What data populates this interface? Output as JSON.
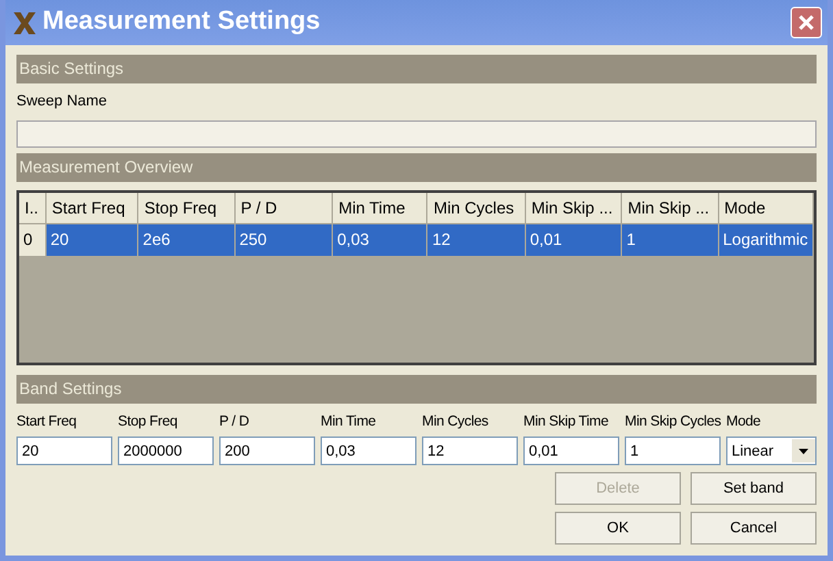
{
  "window": {
    "title": "Measurement Settings"
  },
  "basic": {
    "header": "Basic Settings",
    "sweep_label": "Sweep Name"
  },
  "overview": {
    "header": "Measurement Overview",
    "columns": [
      "I..",
      "Start Freq",
      "Stop Freq",
      "P / D",
      "Min Time",
      "Min Cycles",
      "Min Skip ...",
      "Min Skip ...",
      "Mode"
    ],
    "rows": [
      {
        "cells": [
          "0",
          "20",
          "2e6",
          "250",
          "0,03",
          "12",
          "0,01",
          "1",
          "Logarithmic"
        ],
        "selected": true
      }
    ]
  },
  "band": {
    "header": "Band Settings",
    "fields": [
      {
        "kind": "text",
        "label": "Start Freq",
        "value": "20"
      },
      {
        "kind": "text",
        "label": "Stop Freq",
        "value": "2000000"
      },
      {
        "kind": "text",
        "label": "P / D",
        "value": "200"
      },
      {
        "kind": "text",
        "label": "Min Time",
        "value": "0,03"
      },
      {
        "kind": "text",
        "label": "Min Cycles",
        "value": "12"
      },
      {
        "kind": "text",
        "label": "Min Skip Time",
        "value": "0,01"
      },
      {
        "kind": "text",
        "label": "Min Skip Cycles",
        "value": "1"
      },
      {
        "kind": "select",
        "label": "Mode",
        "value": "Linear"
      }
    ]
  },
  "buttons": [
    [
      {
        "label": "Delete",
        "disabled": true
      },
      {
        "label": "Set band",
        "disabled": false
      }
    ],
    [
      {
        "label": "OK",
        "disabled": false
      },
      {
        "label": "Cancel",
        "disabled": false
      }
    ]
  ]
}
